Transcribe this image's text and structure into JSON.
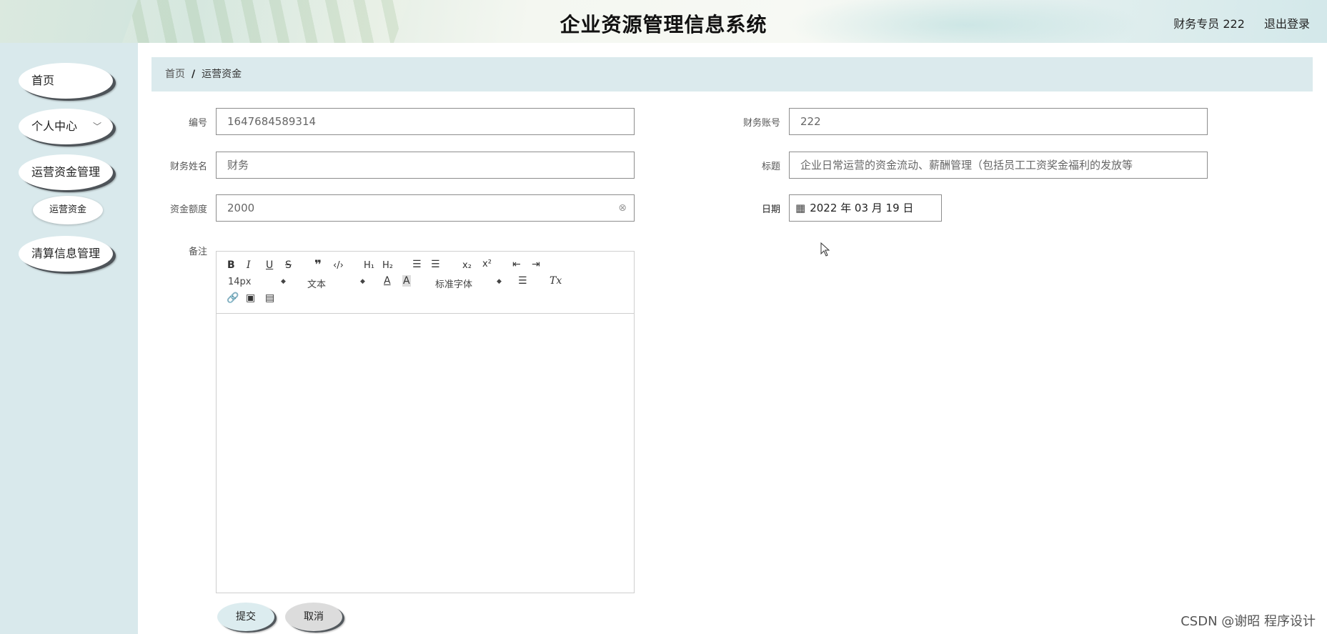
{
  "header": {
    "title": "企业资源管理信息系统",
    "user": "财务专员 222",
    "logout": "退出登录"
  },
  "sidebar": {
    "items": [
      {
        "label": "首页"
      },
      {
        "label": "个人中心"
      },
      {
        "label": "运营资金管理"
      },
      {
        "label": "清算信息管理"
      }
    ],
    "subitem": "运营资金"
  },
  "breadcrumb": {
    "home": "首页",
    "separator": "/",
    "current": "运营资金"
  },
  "form": {
    "number_label": "编号",
    "number_value": "1647684589314",
    "account_label": "财务账号",
    "account_value": "222",
    "name_label": "财务姓名",
    "name_value": "财务",
    "title_label": "标题",
    "title_value": "企业日常运营的资金流动、薪酬管理（包括员工工资奖金福利的发放等",
    "amount_label": "资金额度",
    "amount_value": "2000",
    "date_label": "日期",
    "date_value": "2022 年 03 月 19 日",
    "remark_label": "备注"
  },
  "editor": {
    "font_size": "14px",
    "header_select": "文本",
    "font_family": "标准字体"
  },
  "buttons": {
    "submit": "提交",
    "cancel": "取消"
  },
  "watermark": "CSDN @谢昭  程序设计",
  "colors": {
    "sidebar_bg": "#d9e9ec",
    "breadcrumb_bg": "#dbeaed",
    "field_border": "#8d8d8d"
  }
}
